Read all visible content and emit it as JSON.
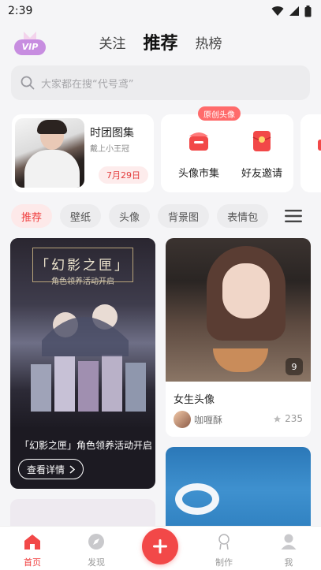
{
  "status": {
    "time": "2:39"
  },
  "vip": {
    "label": "VIP"
  },
  "tabs": [
    {
      "label": "关注"
    },
    {
      "label": "推荐"
    },
    {
      "label": "热榜"
    }
  ],
  "search": {
    "placeholder": "大家都在搜“代号鸢”"
  },
  "feature": {
    "group_title": "时团图集",
    "group_subtitle": "戴上小王冠",
    "date": "7月29日",
    "badge": "原创头像",
    "mini_apps": [
      {
        "label": "头像市集",
        "icon": "shop-icon"
      },
      {
        "label": "好友邀请",
        "icon": "red-envelope-icon"
      }
    ]
  },
  "chips": [
    {
      "label": "推荐"
    },
    {
      "label": "壁纸"
    },
    {
      "label": "头像"
    },
    {
      "label": "背景图"
    },
    {
      "label": "表情包"
    }
  ],
  "feed": {
    "poster": {
      "title": "「幻影之匣」",
      "subtitle": "角色领养活动开启",
      "caption": "「幻影之匣」角色领养活动开启",
      "button": "查看详情"
    },
    "photo": {
      "count": "9",
      "title": "女生头像",
      "author": "咖喱酥",
      "likes": "235"
    }
  },
  "bottom_nav": [
    {
      "label": "首页"
    },
    {
      "label": "发现"
    },
    {
      "label": "制作"
    },
    {
      "label": "我"
    }
  ],
  "colors": {
    "accent": "#f04040",
    "chip_active_bg": "#fde9e9",
    "date_bg": "#fdecec",
    "badge_bg": "#ff6b6b"
  }
}
